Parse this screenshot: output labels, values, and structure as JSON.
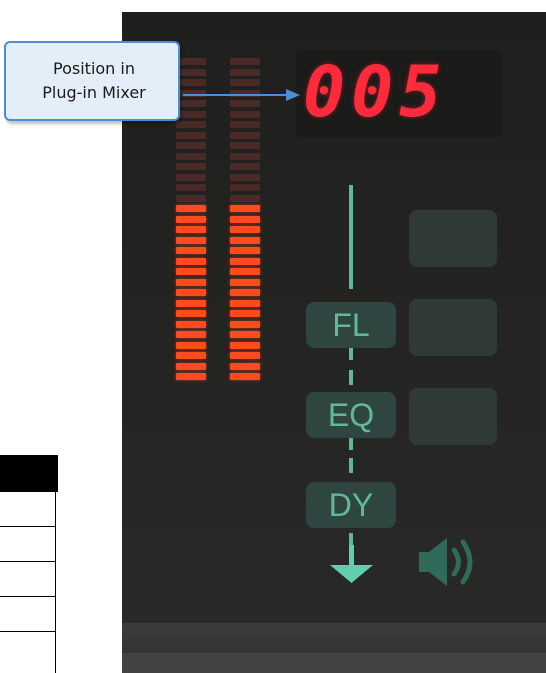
{
  "display": {
    "value": "005"
  },
  "callout": {
    "line1": "Position in",
    "line2": "Plug-in Mixer"
  },
  "modules": [
    {
      "label": "FL"
    },
    {
      "label": "EQ"
    },
    {
      "label": "DY"
    }
  ],
  "meters": {
    "left_level_segments_lit": 17,
    "right_level_segments_lit": 17,
    "total_segments": 31
  },
  "colors": {
    "meter_on": "#ff4a1e",
    "meter_off": "#4a2a26",
    "digits": "#ff2b3a",
    "module_text": "#61b997",
    "callout_border": "#4b8ed6"
  }
}
